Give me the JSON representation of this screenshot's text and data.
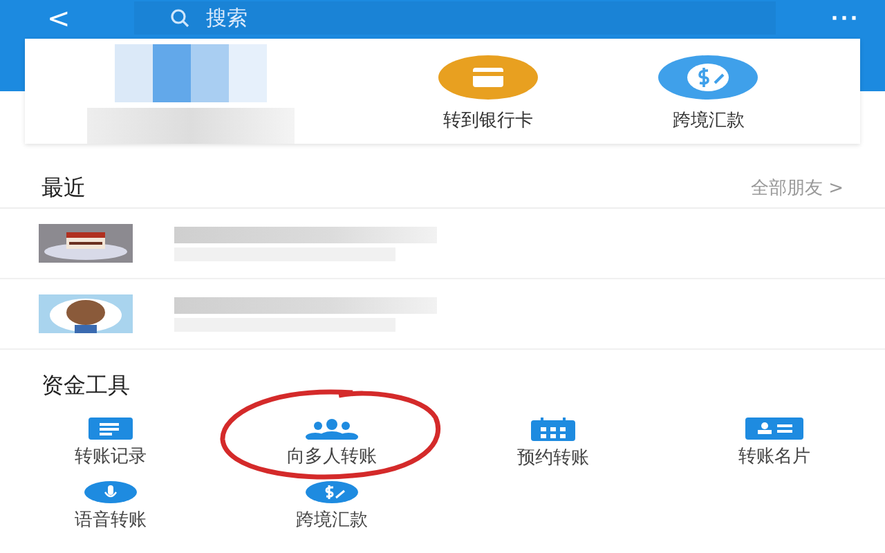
{
  "header": {
    "back": "<",
    "search_placeholder": "搜索",
    "more": "···"
  },
  "top_actions": [
    {
      "label": "转到银行卡",
      "kind": "card"
    },
    {
      "label": "跨境汇款",
      "kind": "dollar"
    }
  ],
  "recent": {
    "title": "最近",
    "link": "全部朋友 >"
  },
  "tools": {
    "title": "资金工具",
    "items": [
      {
        "label": "转账记录",
        "kind": "list",
        "highlighted": false
      },
      {
        "label": "向多人转账",
        "kind": "people",
        "highlighted": true
      },
      {
        "label": "预约转账",
        "kind": "calendar",
        "highlighted": false
      },
      {
        "label": "转账名片",
        "kind": "namecard",
        "highlighted": false
      },
      {
        "label": "语音转账",
        "kind": "mic",
        "highlighted": false
      },
      {
        "label": "跨境汇款",
        "kind": "dollar",
        "highlighted": false
      }
    ]
  }
}
